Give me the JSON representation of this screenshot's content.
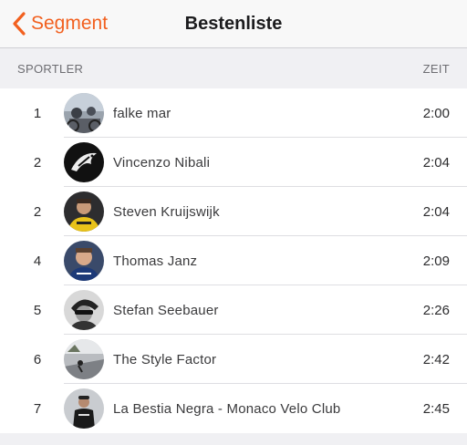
{
  "nav": {
    "back_label": "Segment",
    "title": "Bestenliste"
  },
  "header": {
    "athlete": "SPORTLER",
    "time": "ZEIT"
  },
  "accent_color": "#f2601f",
  "rows": [
    {
      "rank": "1",
      "name": "falke mar",
      "time": "2:00"
    },
    {
      "rank": "2",
      "name": "Vincenzo Nibali",
      "time": "2:04"
    },
    {
      "rank": "2",
      "name": "Steven Kruijswijk",
      "time": "2:04"
    },
    {
      "rank": "4",
      "name": "Thomas Janz",
      "time": "2:09"
    },
    {
      "rank": "5",
      "name": "Stefan Seebauer",
      "time": "2:26"
    },
    {
      "rank": "6",
      "name": "The  Style Factor",
      "time": "2:42"
    },
    {
      "rank": "7",
      "name": "La Bestia Negra - Monaco Velo Club",
      "time": "2:45"
    }
  ]
}
